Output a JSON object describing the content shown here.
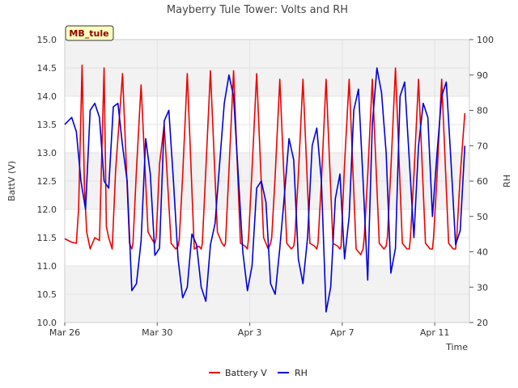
{
  "chart_data": {
    "type": "line",
    "title": "Mayberry Tule Tower: Volts and RH",
    "badge": "MB_tule",
    "xlabel": "Time",
    "ylabel_left": "BattV (V)",
    "ylabel_right": "RH",
    "ylim_left": [
      10.0,
      15.0
    ],
    "ylim_right": [
      20,
      100
    ],
    "xlim": [
      0,
      17.5
    ],
    "left_ticks": [
      "10.0",
      "10.5",
      "11.0",
      "11.5",
      "12.0",
      "12.5",
      "13.0",
      "13.5",
      "14.0",
      "14.5",
      "15.0"
    ],
    "right_ticks": [
      "20",
      "30",
      "40",
      "50",
      "60",
      "70",
      "80",
      "90",
      "100"
    ],
    "x_ticks": [
      {
        "label": "Mar 26",
        "day": 0
      },
      {
        "label": "Mar 30",
        "day": 4
      },
      {
        "label": "Apr 3",
        "day": 8
      },
      {
        "label": "Apr 7",
        "day": 12
      },
      {
        "label": "Apr 11",
        "day": 16
      }
    ],
    "grid": true,
    "legend_position": "bottom-center",
    "series": [
      {
        "name": "Battery V",
        "axis": "left",
        "color": "#ee0000",
        "x": [
          0.0,
          0.3,
          0.5,
          0.6,
          0.75,
          0.85,
          0.95,
          1.1,
          1.3,
          1.5,
          1.7,
          1.8,
          1.9,
          2.05,
          2.2,
          2.5,
          2.8,
          2.9,
          2.95,
          3.1,
          3.3,
          3.6,
          3.8,
          3.9,
          3.95,
          4.1,
          4.3,
          4.6,
          4.8,
          4.9,
          4.95,
          5.1,
          5.3,
          5.6,
          5.8,
          5.9,
          5.95,
          6.1,
          6.3,
          6.6,
          6.8,
          6.9,
          6.95,
          7.1,
          7.3,
          7.6,
          7.8,
          7.9,
          7.95,
          8.1,
          8.3,
          8.6,
          8.8,
          8.9,
          8.95,
          9.1,
          9.3,
          9.6,
          9.8,
          9.9,
          9.95,
          10.1,
          10.3,
          10.6,
          10.8,
          10.9,
          10.95,
          11.1,
          11.3,
          11.6,
          11.8,
          11.9,
          11.95,
          12.1,
          12.3,
          12.6,
          12.8,
          12.9,
          12.95,
          13.1,
          13.3,
          13.6,
          13.8,
          13.9,
          13.95,
          14.1,
          14.3,
          14.6,
          14.8,
          14.9,
          14.95,
          15.1,
          15.3,
          15.6,
          15.8,
          15.9,
          15.95,
          16.1,
          16.3,
          16.6,
          16.8,
          16.9,
          16.95,
          17.1,
          17.3
        ],
        "values": [
          11.48,
          11.42,
          11.4,
          12.0,
          14.55,
          12.4,
          11.6,
          11.3,
          11.5,
          11.45,
          14.5,
          11.7,
          11.5,
          11.3,
          12.7,
          14.4,
          11.4,
          11.3,
          11.4,
          12.7,
          14.2,
          11.6,
          11.45,
          11.4,
          11.5,
          12.8,
          13.5,
          11.4,
          11.3,
          11.35,
          11.45,
          12.6,
          14.4,
          11.3,
          11.35,
          11.3,
          11.4,
          12.7,
          14.45,
          11.6,
          11.4,
          11.35,
          11.4,
          12.7,
          14.45,
          11.4,
          11.35,
          11.3,
          11.5,
          12.7,
          14.4,
          11.5,
          11.3,
          11.4,
          11.5,
          12.6,
          14.3,
          11.4,
          11.3,
          11.35,
          11.5,
          12.6,
          14.3,
          11.4,
          11.35,
          11.3,
          11.4,
          12.5,
          14.3,
          11.4,
          11.35,
          11.3,
          11.35,
          12.8,
          14.3,
          11.3,
          11.2,
          11.3,
          11.5,
          12.6,
          14.3,
          11.4,
          11.3,
          11.35,
          11.5,
          12.7,
          14.5,
          11.4,
          11.3,
          11.3,
          11.5,
          12.6,
          14.3,
          11.4,
          11.3,
          11.3,
          11.5,
          12.6,
          14.3,
          11.4,
          11.3,
          11.3,
          11.5,
          12.6,
          13.7
        ]
      },
      {
        "name": "RH",
        "axis": "right",
        "color": "#0000dd",
        "x": [
          0.0,
          0.3,
          0.5,
          0.7,
          0.9,
          1.1,
          1.3,
          1.5,
          1.7,
          1.9,
          2.1,
          2.3,
          2.5,
          2.7,
          2.9,
          3.1,
          3.3,
          3.5,
          3.7,
          3.9,
          4.1,
          4.3,
          4.5,
          4.7,
          4.9,
          5.1,
          5.3,
          5.5,
          5.7,
          5.9,
          6.1,
          6.3,
          6.5,
          6.7,
          6.9,
          7.1,
          7.3,
          7.5,
          7.7,
          7.9,
          8.1,
          8.3,
          8.5,
          8.7,
          8.9,
          9.1,
          9.3,
          9.5,
          9.7,
          9.9,
          10.1,
          10.3,
          10.5,
          10.7,
          10.9,
          11.1,
          11.3,
          11.5,
          11.7,
          11.9,
          12.1,
          12.3,
          12.5,
          12.7,
          12.9,
          13.1,
          13.3,
          13.5,
          13.7,
          13.9,
          14.1,
          14.3,
          14.5,
          14.7,
          14.9,
          15.1,
          15.3,
          15.5,
          15.7,
          15.9,
          16.1,
          16.3,
          16.5,
          16.7,
          16.9,
          17.1,
          17.3
        ],
        "values": [
          76,
          78,
          74,
          60,
          52,
          80,
          82,
          78,
          60,
          58,
          81,
          82,
          70,
          60,
          29,
          31,
          43,
          72,
          62,
          39,
          41,
          77,
          80,
          60,
          38,
          27,
          30,
          45,
          42,
          30,
          26,
          42,
          48,
          65,
          82,
          90,
          84,
          62,
          40,
          29,
          36,
          58,
          60,
          54,
          31,
          28,
          41,
          56,
          72,
          66,
          38,
          31,
          44,
          70,
          75,
          60,
          23,
          30,
          55,
          62,
          38,
          50,
          80,
          86,
          60,
          32,
          76,
          92,
          85,
          68,
          34,
          41,
          84,
          88,
          66,
          44,
          70,
          82,
          78,
          50,
          68,
          84,
          88,
          66,
          42,
          46,
          70
        ]
      }
    ]
  }
}
